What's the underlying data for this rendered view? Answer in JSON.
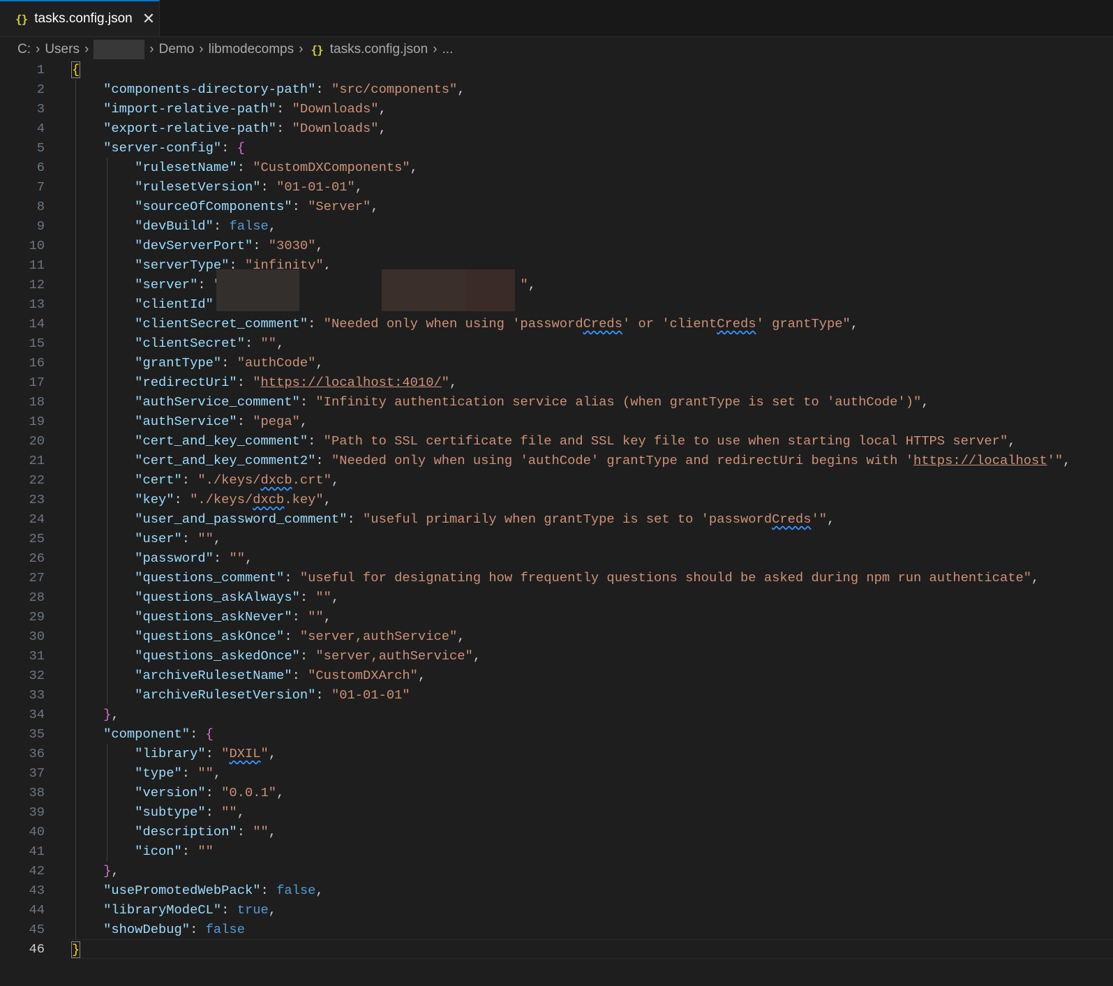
{
  "tab": {
    "icon": "json-braces-icon",
    "label": "tasks.config.json",
    "close": "✕"
  },
  "breadcrumb": {
    "items": [
      "C:",
      "Users",
      "[redacted]",
      "Demo",
      "libmodecomps",
      "tasks.config.json",
      "..."
    ]
  },
  "editor": {
    "current_line": 46,
    "colors": {
      "key": "#9cdcfe",
      "string": "#ce9178",
      "boolean": "#569cd6",
      "brace_outer": "#ffd700",
      "brace_inner": "#da70d6"
    },
    "lines": [
      {
        "i": 0,
        "t": [
          [
            "y",
            "{"
          ]
        ]
      },
      {
        "i": 1,
        "t": [
          [
            "k",
            "\"components-directory-path\""
          ],
          [
            "p",
            ": "
          ],
          [
            "s",
            "\"src/components\""
          ],
          [
            "p",
            ","
          ]
        ]
      },
      {
        "i": 1,
        "t": [
          [
            "k",
            "\"import-relative-path\""
          ],
          [
            "p",
            ": "
          ],
          [
            "s",
            "\"Downloads\""
          ],
          [
            "p",
            ","
          ]
        ]
      },
      {
        "i": 1,
        "t": [
          [
            "k",
            "\"export-relative-path\""
          ],
          [
            "p",
            ": "
          ],
          [
            "s",
            "\"Downloads\""
          ],
          [
            "p",
            ","
          ]
        ]
      },
      {
        "i": 1,
        "t": [
          [
            "k",
            "\"server-config\""
          ],
          [
            "p",
            ": "
          ],
          [
            "m",
            "{"
          ]
        ]
      },
      {
        "i": 2,
        "t": [
          [
            "k",
            "\"rulesetName\""
          ],
          [
            "p",
            ": "
          ],
          [
            "s",
            "\"CustomDXComponents\""
          ],
          [
            "p",
            ","
          ]
        ]
      },
      {
        "i": 2,
        "t": [
          [
            "k",
            "\"rulesetVersion\""
          ],
          [
            "p",
            ": "
          ],
          [
            "s",
            "\"01-01-01\""
          ],
          [
            "p",
            ","
          ]
        ]
      },
      {
        "i": 2,
        "t": [
          [
            "k",
            "\"sourceOfComponents\""
          ],
          [
            "p",
            ": "
          ],
          [
            "s",
            "\"Server\""
          ],
          [
            "p",
            ","
          ]
        ]
      },
      {
        "i": 2,
        "t": [
          [
            "k",
            "\"devBuild\""
          ],
          [
            "p",
            ": "
          ],
          [
            "b",
            "false"
          ],
          [
            "p",
            ","
          ]
        ]
      },
      {
        "i": 2,
        "t": [
          [
            "k",
            "\"devServerPort\""
          ],
          [
            "p",
            ": "
          ],
          [
            "s",
            "\"3030\""
          ],
          [
            "p",
            ","
          ]
        ]
      },
      {
        "i": 2,
        "t": [
          [
            "k",
            "\"serverType\""
          ],
          [
            "p",
            ": "
          ],
          [
            "s",
            "\"infinity\""
          ],
          [
            "p",
            ","
          ]
        ]
      },
      {
        "i": 2,
        "t": [
          [
            "k",
            "\"server\""
          ],
          [
            "p",
            ": "
          ],
          [
            "s",
            "\"                                      \""
          ],
          [
            "p",
            ","
          ]
        ]
      },
      {
        "i": 2,
        "t": [
          [
            "k",
            "\"clientId\""
          ]
        ]
      },
      {
        "i": 2,
        "t": [
          [
            "k",
            "\"clientSecret_comment\""
          ],
          [
            "p",
            ": "
          ],
          [
            "s",
            "\"Needed only when using 'password"
          ],
          [
            "q",
            "Creds"
          ],
          [
            "s",
            "' or 'client"
          ],
          [
            "q",
            "Creds"
          ],
          [
            "s",
            "' grantType\""
          ],
          [
            "p",
            ","
          ]
        ]
      },
      {
        "i": 2,
        "t": [
          [
            "k",
            "\"clientSecret\""
          ],
          [
            "p",
            ": "
          ],
          [
            "s",
            "\"\""
          ],
          [
            "p",
            ","
          ]
        ]
      },
      {
        "i": 2,
        "t": [
          [
            "k",
            "\"grantType\""
          ],
          [
            "p",
            ": "
          ],
          [
            "s",
            "\"authCode\""
          ],
          [
            "p",
            ","
          ]
        ]
      },
      {
        "i": 2,
        "t": [
          [
            "k",
            "\"redirectUri\""
          ],
          [
            "p",
            ": "
          ],
          [
            "s",
            "\""
          ],
          [
            "u",
            "https://localhost:4010/"
          ],
          [
            "s",
            "\""
          ],
          [
            "p",
            ","
          ]
        ]
      },
      {
        "i": 2,
        "t": [
          [
            "k",
            "\"authService_comment\""
          ],
          [
            "p",
            ": "
          ],
          [
            "s",
            "\"Infinity authentication service alias (when grantType is set to 'authCode')\""
          ],
          [
            "p",
            ","
          ]
        ]
      },
      {
        "i": 2,
        "t": [
          [
            "k",
            "\"authService\""
          ],
          [
            "p",
            ": "
          ],
          [
            "s",
            "\"pega\""
          ],
          [
            "p",
            ","
          ]
        ]
      },
      {
        "i": 2,
        "t": [
          [
            "k",
            "\"cert_and_key_comment\""
          ],
          [
            "p",
            ": "
          ],
          [
            "s",
            "\"Path to SSL certificate file and SSL key file to use when starting local HTTPS server\""
          ],
          [
            "p",
            ","
          ]
        ]
      },
      {
        "i": 2,
        "t": [
          [
            "k",
            "\"cert_and_key_comment2\""
          ],
          [
            "p",
            ": "
          ],
          [
            "s",
            "\"Needed only when using 'authCode' grantType and redirectUri begins with '"
          ],
          [
            "u",
            "https://localhost"
          ],
          [
            "s",
            "'\""
          ],
          [
            "p",
            ","
          ]
        ]
      },
      {
        "i": 2,
        "t": [
          [
            "k",
            "\"cert\""
          ],
          [
            "p",
            ": "
          ],
          [
            "s",
            "\"./keys/"
          ],
          [
            "q",
            "dxcb"
          ],
          [
            "s",
            ".crt\""
          ],
          [
            "p",
            ","
          ]
        ]
      },
      {
        "i": 2,
        "t": [
          [
            "k",
            "\"key\""
          ],
          [
            "p",
            ": "
          ],
          [
            "s",
            "\"./keys/"
          ],
          [
            "q",
            "dxcb"
          ],
          [
            "s",
            ".key\""
          ],
          [
            "p",
            ","
          ]
        ]
      },
      {
        "i": 2,
        "t": [
          [
            "k",
            "\"user_and_password_comment\""
          ],
          [
            "p",
            ": "
          ],
          [
            "s",
            "\"useful primarily when grantType is set to 'password"
          ],
          [
            "q",
            "Creds"
          ],
          [
            "s",
            "'\""
          ],
          [
            "p",
            ","
          ]
        ]
      },
      {
        "i": 2,
        "t": [
          [
            "k",
            "\"user\""
          ],
          [
            "p",
            ": "
          ],
          [
            "s",
            "\"\""
          ],
          [
            "p",
            ","
          ]
        ]
      },
      {
        "i": 2,
        "t": [
          [
            "k",
            "\"password\""
          ],
          [
            "p",
            ": "
          ],
          [
            "s",
            "\"\""
          ],
          [
            "p",
            ","
          ]
        ]
      },
      {
        "i": 2,
        "t": [
          [
            "k",
            "\"questions_comment\""
          ],
          [
            "p",
            ": "
          ],
          [
            "s",
            "\"useful for designating how frequently questions should be asked during npm run authenticate\""
          ],
          [
            "p",
            ","
          ]
        ]
      },
      {
        "i": 2,
        "t": [
          [
            "k",
            "\"questions_askAlways\""
          ],
          [
            "p",
            ": "
          ],
          [
            "s",
            "\"\""
          ],
          [
            "p",
            ","
          ]
        ]
      },
      {
        "i": 2,
        "t": [
          [
            "k",
            "\"questions_askNever\""
          ],
          [
            "p",
            ": "
          ],
          [
            "s",
            "\"\""
          ],
          [
            "p",
            ","
          ]
        ]
      },
      {
        "i": 2,
        "t": [
          [
            "k",
            "\"questions_askOnce\""
          ],
          [
            "p",
            ": "
          ],
          [
            "s",
            "\"server,authService\""
          ],
          [
            "p",
            ","
          ]
        ]
      },
      {
        "i": 2,
        "t": [
          [
            "k",
            "\"questions_askedOnce\""
          ],
          [
            "p",
            ": "
          ],
          [
            "s",
            "\"server,authService\""
          ],
          [
            "p",
            ","
          ]
        ]
      },
      {
        "i": 2,
        "t": [
          [
            "k",
            "\"archiveRulesetName\""
          ],
          [
            "p",
            ": "
          ],
          [
            "s",
            "\"CustomDXArch\""
          ],
          [
            "p",
            ","
          ]
        ]
      },
      {
        "i": 2,
        "t": [
          [
            "k",
            "\"archiveRulesetVersion\""
          ],
          [
            "p",
            ": "
          ],
          [
            "s",
            "\"01-01-01\""
          ]
        ]
      },
      {
        "i": 1,
        "t": [
          [
            "m",
            "}"
          ],
          [
            "p",
            ","
          ]
        ]
      },
      {
        "i": 1,
        "t": [
          [
            "k",
            "\"component\""
          ],
          [
            "p",
            ": "
          ],
          [
            "m",
            "{"
          ]
        ]
      },
      {
        "i": 2,
        "t": [
          [
            "k",
            "\"library\""
          ],
          [
            "p",
            ": "
          ],
          [
            "s",
            "\""
          ],
          [
            "q",
            "DXIL"
          ],
          [
            "s",
            "\""
          ],
          [
            "p",
            ","
          ]
        ]
      },
      {
        "i": 2,
        "t": [
          [
            "k",
            "\"type\""
          ],
          [
            "p",
            ": "
          ],
          [
            "s",
            "\"\""
          ],
          [
            "p",
            ","
          ]
        ]
      },
      {
        "i": 2,
        "t": [
          [
            "k",
            "\"version\""
          ],
          [
            "p",
            ": "
          ],
          [
            "s",
            "\"0.0.1\""
          ],
          [
            "p",
            ","
          ]
        ]
      },
      {
        "i": 2,
        "t": [
          [
            "k",
            "\"subtype\""
          ],
          [
            "p",
            ": "
          ],
          [
            "s",
            "\"\""
          ],
          [
            "p",
            ","
          ]
        ]
      },
      {
        "i": 2,
        "t": [
          [
            "k",
            "\"description\""
          ],
          [
            "p",
            ": "
          ],
          [
            "s",
            "\"\""
          ],
          [
            "p",
            ","
          ]
        ]
      },
      {
        "i": 2,
        "t": [
          [
            "k",
            "\"icon\""
          ],
          [
            "p",
            ": "
          ],
          [
            "s",
            "\"\""
          ]
        ]
      },
      {
        "i": 1,
        "t": [
          [
            "m",
            "}"
          ],
          [
            "p",
            ","
          ]
        ]
      },
      {
        "i": 1,
        "t": [
          [
            "k",
            "\"usePromotedWebPack\""
          ],
          [
            "p",
            ": "
          ],
          [
            "b",
            "false"
          ],
          [
            "p",
            ","
          ]
        ]
      },
      {
        "i": 1,
        "t": [
          [
            "k",
            "\"libraryModeCL\""
          ],
          [
            "p",
            ": "
          ],
          [
            "b",
            "true"
          ],
          [
            "p",
            ","
          ]
        ]
      },
      {
        "i": 1,
        "t": [
          [
            "k",
            "\"showDebug\""
          ],
          [
            "p",
            ": "
          ],
          [
            "b",
            "false"
          ]
        ]
      },
      {
        "i": 0,
        "t": [
          [
            "y",
            "}"
          ]
        ]
      }
    ]
  }
}
